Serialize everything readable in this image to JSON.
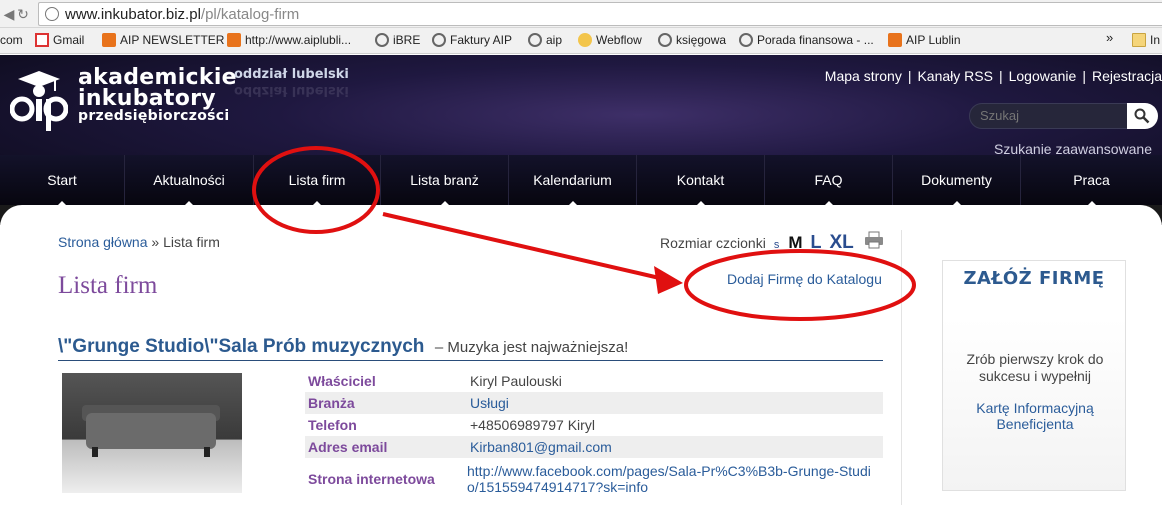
{
  "browser": {
    "url_domain": "www.inkubator.biz.pl",
    "url_path": "/pl/katalog-firm",
    "bookmarks": [
      {
        "label": "com",
        "icon": "none"
      },
      {
        "label": "Gmail",
        "icon": "gmail-icon"
      },
      {
        "label": "AIP NEWSLETTER",
        "icon": "aip-icon"
      },
      {
        "label": "http://www.aiplubli...",
        "icon": "aip-icon"
      },
      {
        "label": "iBRE",
        "icon": "globe-icon"
      },
      {
        "label": "Faktury AIP",
        "icon": "globe-icon"
      },
      {
        "label": "aip",
        "icon": "globe-icon"
      },
      {
        "label": "Webflow",
        "icon": "webflow-icon"
      },
      {
        "label": "księgowa",
        "icon": "globe-icon"
      },
      {
        "label": "Porada finansowa - ...",
        "icon": "globe-icon"
      },
      {
        "label": "AIP Lublin",
        "icon": "aip-icon"
      },
      {
        "label": "In",
        "icon": "folder-icon"
      }
    ],
    "more_bookmarks": "»"
  },
  "header": {
    "logo_line1": "akademickie",
    "logo_line2": "inkubatory",
    "logo_line3": "przedsiębiorczości",
    "branch": "oddział lubelski",
    "top_links": [
      "Mapa strony",
      "Kanały RSS",
      "Logowanie",
      "Rejestracja"
    ],
    "search_placeholder": "Szukaj",
    "advanced_search": "Szukanie zaawansowane"
  },
  "nav": [
    "Start",
    "Aktualności",
    "Lista firm",
    "Lista branż",
    "Kalendarium",
    "Kontakt",
    "FAQ",
    "Dokumenty",
    "Praca"
  ],
  "main": {
    "breadcrumb_home": "Strona główna",
    "breadcrumb_sep": "»",
    "breadcrumb_current": "Lista firm",
    "font_size_label": "Rozmiar czcionki",
    "font_sizes": [
      "s",
      "M",
      "L",
      "XL"
    ],
    "page_title": "Lista firm",
    "add_company": "Dodaj Firmę do Katalogu",
    "company": {
      "name": "\\\"Grunge Studio\\\"Sala Prób muzycznych",
      "tagline": "– Muzyka jest najważniejsza!",
      "fields": [
        {
          "label": "Właściciel",
          "value": "Kiryl Paulouski",
          "link": false
        },
        {
          "label": "Branża",
          "value": "Usługi",
          "link": true
        },
        {
          "label": "Telefon",
          "value": "+48506989797 Kiryl",
          "link": false
        },
        {
          "label": "Adres email",
          "value": "Kirban801@gmail.com",
          "link": true
        },
        {
          "label": "Strona internetowa",
          "value": "http://www.facebook.com/pages/Sala-Pr%C3%B3b-Grunge-Studio/151559474914717?sk=info",
          "link": true
        }
      ]
    }
  },
  "sidebar": {
    "title": "ZAŁÓŻ FIRMĘ",
    "text": "Zrób pierwszy krok do sukcesu i wypełnij",
    "link": "Kartę Informacyjną Beneficjenta"
  },
  "colors": {
    "accent_purple": "#7d4a9c",
    "link_blue": "#2a5c9a",
    "annotation_red": "#e01010"
  }
}
